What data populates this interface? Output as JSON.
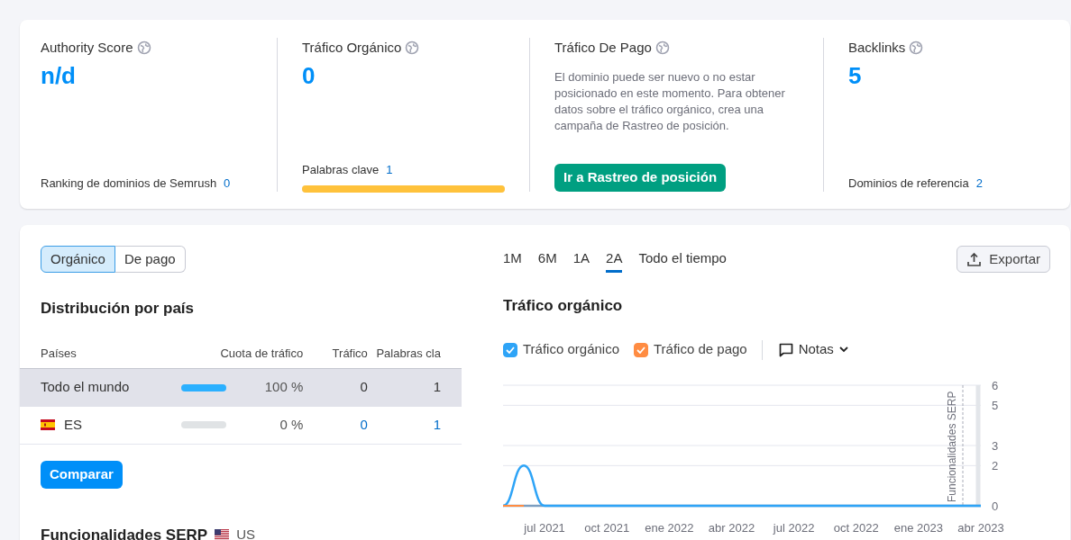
{
  "metrics": [
    {
      "title": "Authority Score",
      "value": "n/d",
      "footer": {
        "label": "Ranking de dominios de Semrush",
        "value": "0"
      }
    },
    {
      "title": "Tráfico Orgánico",
      "value": "0",
      "footer": {
        "label": "Palabras clave",
        "value": "1"
      },
      "bar": {
        "level": 1
      }
    },
    {
      "title": "Tráfico De Pago",
      "description": "El dominio puede ser nuevo o no estar posicionado en este momento. Para obtener datos sobre el tráfico orgánico, crea una campaña de Rastreo de posición.",
      "button": "Ir a Rastreo de posición"
    },
    {
      "title": "Backlinks",
      "value": "5",
      "footer": {
        "label": "Dominios de referencia",
        "value": "2"
      }
    }
  ],
  "source_toggle": [
    {
      "label": "Orgánico",
      "selected": true
    },
    {
      "label": "De pago",
      "selected": false
    }
  ],
  "distribution": {
    "title": "Distribución por país",
    "columns": [
      "Países",
      "Cuota de tráfico",
      "Tráfico",
      "Palabras cla"
    ],
    "rows": [
      {
        "kind": "total",
        "name": "Todo el mundo",
        "level": 1,
        "share": "100 %",
        "traffic": "0",
        "keywords": "1",
        "selected": true
      },
      {
        "kind": "country",
        "name": "ES",
        "level": 0,
        "share": "0 %",
        "traffic": "0",
        "keywords": "1",
        "selected": false
      }
    ],
    "compare_button": "Comparar"
  },
  "serp": {
    "title": "Funcionalidades SERP",
    "country": "US"
  },
  "periods": [
    {
      "label": "1M",
      "selected": false
    },
    {
      "label": "6M",
      "selected": false
    },
    {
      "label": "1A",
      "selected": false
    },
    {
      "label": "2A",
      "selected": true
    },
    {
      "label": "Todo el tiempo",
      "selected": false
    }
  ],
  "export_button": "Exportar",
  "chart_title": "Tráfico orgánico",
  "legend": [
    {
      "checked": true
    },
    {
      "checked": true
    }
  ],
  "notes_button": "Notas",
  "chart_data": {
    "type": "line",
    "ylim": [
      0,
      6
    ],
    "grid": true,
    "categories": [
      null,
      null,
      "jul 2021",
      null,
      null,
      "oct 2021",
      null,
      null,
      "ene 2022",
      null,
      null,
      "abr 2022",
      null,
      null,
      "jul 2022",
      null,
      null,
      "oct 2022",
      null,
      null,
      "ene 2023",
      null,
      null,
      "abr 2023"
    ],
    "yticks": [
      0,
      2,
      3,
      5,
      6
    ],
    "series": [
      {
        "name": "Tráfico orgánico",
        "color": "#2ea4f7",
        "values": [
          0,
          2,
          0,
          0,
          0,
          0,
          0,
          0,
          0,
          0,
          0,
          0,
          0,
          0,
          0,
          0,
          0,
          0,
          0,
          0,
          0,
          0,
          0,
          0
        ]
      },
      {
        "name": "Tráfico de pago",
        "color": "#ff8c42",
        "values": [
          0,
          0,
          null,
          null,
          null,
          null,
          null,
          null,
          null,
          null,
          null,
          null,
          null,
          null,
          null,
          null,
          null,
          null,
          null,
          null,
          null,
          null,
          null,
          null
        ]
      }
    ],
    "annotations": [
      "Funcionalidades SERP"
    ]
  }
}
